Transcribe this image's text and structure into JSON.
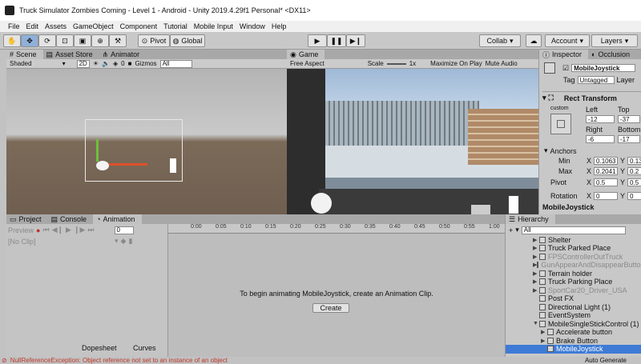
{
  "window_title": "Truck Simulator Zombies Coming - Level 1 - Android - Unity 2019.4.29f1 Personal* <DX11>",
  "menu": [
    "File",
    "Edit",
    "Assets",
    "GameObject",
    "Component",
    "Tutorial",
    "Mobile Input",
    "Window",
    "Help"
  ],
  "toolbar": {
    "pivot": "Pivot",
    "global": "Global",
    "collab": "Collab",
    "account": "Account",
    "layers": "Layers"
  },
  "scene": {
    "tabs": [
      "Scene",
      "Asset Store",
      "Animator"
    ],
    "shading": "Shaded",
    "mode_2d": "2D",
    "fx_count": "0",
    "gizmos": "Gizmos",
    "search_placeholder": "All"
  },
  "game": {
    "tab": "Game",
    "aspect": "Free Aspect",
    "scale_label": "Scale",
    "scale_value": "1x",
    "maximize": "Maximize On Play",
    "mute": "Mute Audio"
  },
  "inspector": {
    "tabs": [
      "Inspector",
      "Occlusion"
    ],
    "object_name": "MobileJoystick",
    "tag_label": "Tag",
    "tag_value": "Untagged",
    "layer_label": "Layer",
    "rect_transform": "Rect Transform",
    "anchor_preset": "custom",
    "left_label": "Left",
    "left": "-12",
    "top_label": "Top",
    "top": "-37",
    "right_label": "Right",
    "right": "-6",
    "bottom_label": "Bottom",
    "bottom": "-17",
    "anchors_label": "Anchors",
    "min_label": "Min",
    "min_x": "0.1063",
    "min_y": "0.133",
    "max_label": "Max",
    "max_x": "0.2041",
    "max_y": "0.2",
    "pivot_label": "Pivot",
    "pivot_x": "0.5",
    "pivot_y": "0.5",
    "rotation_label": "Rotation",
    "rot_x": "0",
    "rot_y": "0",
    "x": "X",
    "y": "Y",
    "footer": "MobileJoystick"
  },
  "bottom": {
    "tabs": [
      "Project",
      "Console",
      "Animation"
    ],
    "preview": "Preview",
    "no_clip": "[No Clip]",
    "frame": "0",
    "ruler": [
      "0:00",
      "0:05",
      "0:10",
      "0:15",
      "0:20",
      "0:25",
      "0:30",
      "0:35",
      "0:40",
      "0:45",
      "0:50",
      "0:55",
      "1:00"
    ],
    "message": "To begin animating MobileJoystick, create an Animation Clip.",
    "create": "Create",
    "dopesheet": "Dopesheet",
    "curves": "Curves"
  },
  "hierarchy": {
    "tab": "Hierarchy",
    "search_placeholder": "All",
    "items": [
      {
        "label": "Shelter",
        "indent": 0,
        "arrow": "▶",
        "dim": false,
        "sel": false
      },
      {
        "label": "Truck Parked Place",
        "indent": 0,
        "arrow": "▶",
        "dim": false,
        "sel": false
      },
      {
        "label": "FPSControllerOutTruck",
        "indent": 0,
        "arrow": "▶",
        "dim": true,
        "sel": false
      },
      {
        "label": "GunAppearAndDisappearButton",
        "indent": 0,
        "arrow": "▶",
        "dim": true,
        "sel": false
      },
      {
        "label": "Terrain holder",
        "indent": 0,
        "arrow": "▶",
        "dim": false,
        "sel": false
      },
      {
        "label": "Truck Parking Place",
        "indent": 0,
        "arrow": "▶",
        "dim": false,
        "sel": false
      },
      {
        "label": "SportCar20_Driver_USA",
        "indent": 0,
        "arrow": "▶",
        "dim": true,
        "sel": false
      },
      {
        "label": "Post FX",
        "indent": 0,
        "arrow": "",
        "dim": false,
        "sel": false
      },
      {
        "label": "Directional Light (1)",
        "indent": 0,
        "arrow": "",
        "dim": false,
        "sel": false
      },
      {
        "label": "EventSystem",
        "indent": 0,
        "arrow": "",
        "dim": false,
        "sel": false
      },
      {
        "label": "MobileSingleStickControl (1)",
        "indent": 0,
        "arrow": "▼",
        "dim": false,
        "sel": false
      },
      {
        "label": "Accelerate button",
        "indent": 1,
        "arrow": "▶",
        "dim": false,
        "sel": false
      },
      {
        "label": "Brake Button",
        "indent": 1,
        "arrow": "▶",
        "dim": false,
        "sel": false
      },
      {
        "label": "MobileJoystick",
        "indent": 1,
        "arrow": "",
        "dim": false,
        "sel": true
      }
    ],
    "auto_generate": "Auto Generate"
  },
  "status": "NullReferenceException: Object reference not set to an instance of an object",
  "colors": {
    "selection": "#3e7bd6",
    "error": "#c0392b",
    "active_tool": "#8fb0d9"
  }
}
